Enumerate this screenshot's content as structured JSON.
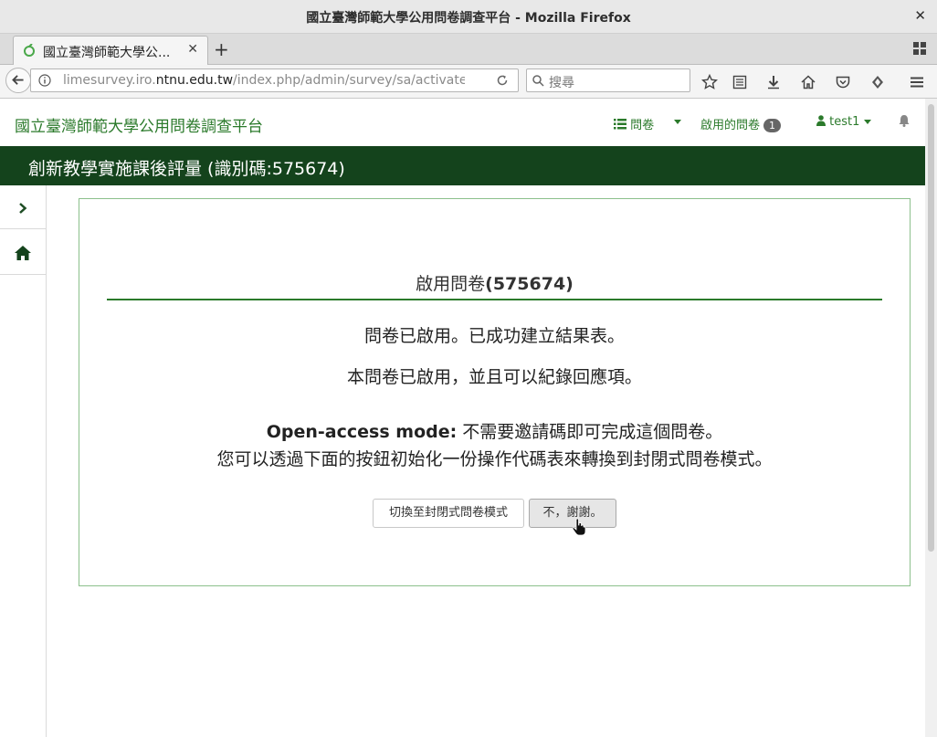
{
  "window": {
    "title": "國立臺灣師範大學公用問卷調查平台 - Mozilla Firefox",
    "close_glyph": "✕"
  },
  "tab": {
    "label": "國立臺灣師範大學公...",
    "close_glyph": "✕",
    "new_tab_glyph": "+"
  },
  "urlbar": {
    "prefix": "limesurvey.iro.",
    "domain": "ntnu.edu.tw",
    "path": "/index.php/admin/survey/sa/activate/surve"
  },
  "searchbar": {
    "placeholder": "搜尋"
  },
  "toolbar_icons": [
    "star-icon",
    "reading-list-icon",
    "download-icon",
    "home-icon",
    "pocket-icon",
    "sync-icon",
    "menu-icon"
  ],
  "app": {
    "brand": "國立臺灣師範大學公用問卷調查平台",
    "nav": {
      "surveys": "問卷",
      "active_surveys": "啟用的問卷",
      "active_count": "1",
      "user": "test1"
    },
    "survey_title": "創新教學實施課後評量 (識別碼:575674)"
  },
  "panel": {
    "title": "啟用問卷",
    "title_id": "(575674)",
    "line1": "問卷已啟用。已成功建立結果表。",
    "line2": "本問卷已啟用，並且可以紀錄回應項。",
    "mode_label": "Open-access mode:",
    "mode_text": " 不需要邀請碼即可完成這個問卷。",
    "line4": "您可以透過下面的按鈕初始化一份操作代碼表來轉換到封閉式問卷模式。",
    "switch_button": "切換至封閉式問卷模式",
    "no_button": "不，謝謝。"
  },
  "colors": {
    "brand_green": "#2b7a2b",
    "dark_green": "#14431c",
    "panel_border": "#8cc08c"
  }
}
